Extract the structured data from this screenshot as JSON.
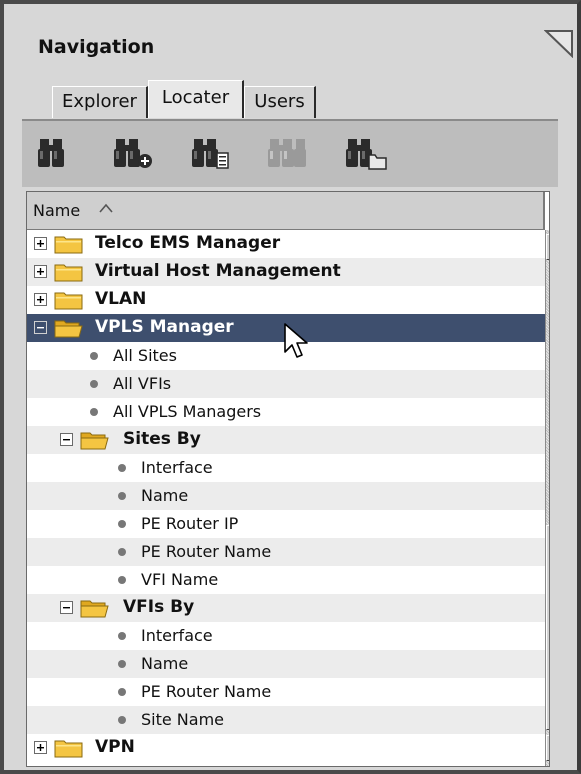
{
  "panel": {
    "title": "Navigation",
    "collapse_icon": "collapse-triangle-icon"
  },
  "tabs": [
    {
      "label": "Explorer",
      "active": false
    },
    {
      "label": "Locater",
      "active": true
    },
    {
      "label": "Users",
      "active": false
    }
  ],
  "toolbar": {
    "buttons": [
      {
        "icon": "binoculars-icon",
        "enabled": true
      },
      {
        "icon": "binoculars-add-icon",
        "enabled": true
      },
      {
        "icon": "binoculars-list-icon",
        "enabled": true
      },
      {
        "icon": "binoculars-disabled-icon",
        "enabled": false
      },
      {
        "icon": "binoculars-folder-icon",
        "enabled": true
      }
    ]
  },
  "tree": {
    "column_header": "Name",
    "sort": "ascending",
    "rows": [
      {
        "label": "Telco EMS Manager",
        "type": "folder",
        "level": 0,
        "expanded": false
      },
      {
        "label": "Virtual Host Management",
        "type": "folder",
        "level": 0,
        "expanded": false
      },
      {
        "label": "VLAN",
        "type": "folder",
        "level": 0,
        "expanded": false
      },
      {
        "label": "VPLS Manager",
        "type": "folder",
        "level": 0,
        "expanded": true,
        "selected": true
      },
      {
        "label": "All Sites",
        "type": "item",
        "level": 1
      },
      {
        "label": "All VFIs",
        "type": "item",
        "level": 1
      },
      {
        "label": "All VPLS Managers",
        "type": "item",
        "level": 1
      },
      {
        "label": "Sites By",
        "type": "folder",
        "level": 1,
        "expanded": true
      },
      {
        "label": "Interface",
        "type": "item",
        "level": 2
      },
      {
        "label": "Name",
        "type": "item",
        "level": 2
      },
      {
        "label": "PE Router IP",
        "type": "item",
        "level": 2
      },
      {
        "label": "PE Router Name",
        "type": "item",
        "level": 2
      },
      {
        "label": "VFI Name",
        "type": "item",
        "level": 2
      },
      {
        "label": "VFIs By",
        "type": "folder",
        "level": 1,
        "expanded": true
      },
      {
        "label": "Interface",
        "type": "item",
        "level": 2
      },
      {
        "label": "Name",
        "type": "item",
        "level": 2
      },
      {
        "label": "PE Router Name",
        "type": "item",
        "level": 2
      },
      {
        "label": "Site Name",
        "type": "item",
        "level": 2
      },
      {
        "label": "VPN",
        "type": "folder",
        "level": 0,
        "expanded": false
      }
    ]
  },
  "colors": {
    "selected_row": "#3e4f6e",
    "folder": "#f4c542",
    "alt_row": "#ececec"
  }
}
